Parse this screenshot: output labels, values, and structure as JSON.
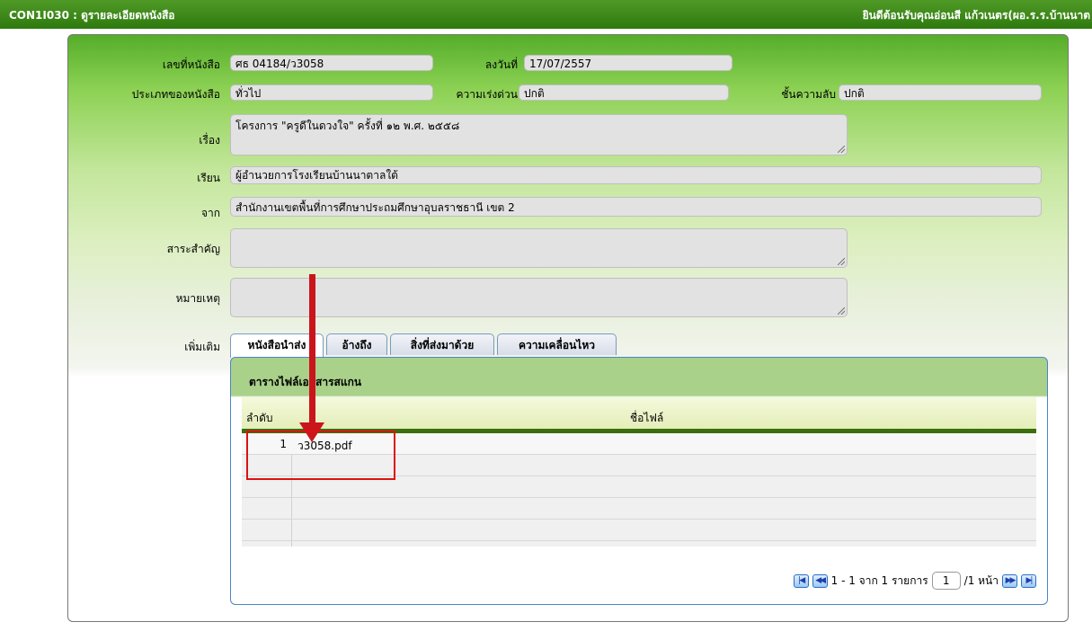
{
  "titlebar": {
    "left": "CON1I030 : ดูรายละเอียดหนังสือ",
    "right": "ยินดีต้อนรับคุณอ่อนสี แก้วเนตร(ผอ.ร.ร.บ้านนาต"
  },
  "form": {
    "doc_no_label": "เลขที่หนังสือ",
    "doc_no_value": "ศธ 04184/ว3058",
    "date_label": "ลงวันที่",
    "date_value": "17/07/2557",
    "type_label": "ประเภทของหนังสือ",
    "type_value": "ทั่วไป",
    "urgency_label": "ความเร่งด่วน",
    "urgency_value": "ปกติ",
    "secrecy_label": "ชั้นความลับ",
    "secrecy_value": "ปกติ",
    "subject_label": "เรื่อง",
    "subject_value": "โครงการ \"ครูดีในดวงใจ\" ครั้งที่ ๑๒ พ.ศ. ๒๕๕๘",
    "to_label": "เรียน",
    "to_value": "ผู้อำนวยการโรงเรียนบ้านนาตาลใต้",
    "from_label": "จาก",
    "from_value": "สำนักงานเขตพื้นที่การศึกษาประถมศึกษาอุบลราชธานี เขต 2",
    "essence_label": "สาระสำคัญ",
    "essence_value": "",
    "note_label": "หมายเหตุ",
    "note_value": "",
    "extra_label": "เพิ่มเติม"
  },
  "tabs": [
    {
      "label": "หนังสือนำส่ง",
      "active": true
    },
    {
      "label": "อ้างถึง",
      "active": false
    },
    {
      "label": "สิ่งที่ส่งมาด้วย",
      "active": false
    },
    {
      "label": "ความเคลื่อนไหว",
      "active": false
    }
  ],
  "panel": {
    "title": "ตารางไฟล์เอกสารสแกน",
    "col_no": "ลำดับ",
    "col_name": "ชื่อไฟล์",
    "rows": [
      {
        "idx": "1",
        "name": "ว3058.pdf"
      }
    ]
  },
  "pager": {
    "range_text": "1 - 1 จาก 1 รายการ",
    "page": "1",
    "total_text": "/1 หน้า"
  },
  "colors": {
    "titlebar": "#2f7a0e",
    "grid_header_border": "#3b6f0e",
    "annotation_red": "#c9151b"
  }
}
